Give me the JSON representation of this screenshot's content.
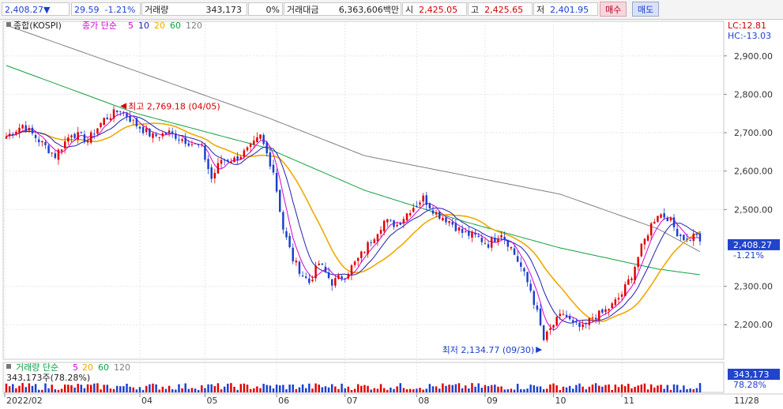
{
  "quote": {
    "price": "2,408.27",
    "change": "29.59",
    "change_pct": "-1.21%",
    "volume_label": "거래량",
    "volume": "343,173",
    "volume_ratio": "0%",
    "amount_label": "거래대금",
    "amount": "6,363,606백만",
    "open_label": "시",
    "open": "2,425.05",
    "high_label": "고",
    "high": "2,425.65",
    "low_label": "저",
    "low": "2,401.95",
    "buy_label": "매수",
    "sell_label": "매도"
  },
  "legend": {
    "symbol": "종합(KOSPI)",
    "price_label": "종가 단순",
    "ma": [
      "5",
      "10",
      "20",
      "60",
      "120"
    ],
    "vol_label": "거래량 단순",
    "vol_ma": [
      "5",
      "20",
      "60",
      "120"
    ],
    "vol_value": "343,173주(78.28%)"
  },
  "colors": {
    "up": "#e00000",
    "down": "#1a3fcf",
    "ma5": "#d400d4",
    "ma10": "#2020b0",
    "ma20": "#f0a800",
    "ma60": "#10a040",
    "ma120": "#808080",
    "price_box": "#2244cc"
  },
  "lc_hc": {
    "lc": "LC:12.81",
    "hc": "HC:-13.03"
  },
  "current_box": {
    "price": "2,408.27",
    "pct": "-1.21%"
  },
  "volume_box": {
    "value": "343,173",
    "pct": "78.28%"
  },
  "chart_data": {
    "type": "candlestick",
    "y_axis_ticks": [
      "2,900.00",
      "2,800.00",
      "2,700.00",
      "2,600.00",
      "2,500.00",
      "2,300.00",
      "2,200.00"
    ],
    "ylim": [
      2110,
      2990
    ],
    "x_axis_ticks": [
      "2022/02",
      "04",
      "05",
      "06",
      "07",
      "08",
      "09",
      "10",
      "11",
      "11/28"
    ],
    "annotations": {
      "high": {
        "text": "최고 2,769.18 (04/05)",
        "value": 2769.18
      },
      "low": {
        "text": "최저 2,134.77 (09/30)",
        "value": 2134.77
      }
    },
    "close_anchors": [
      [
        0,
        2690
      ],
      [
        5,
        2720
      ],
      [
        10,
        2680
      ],
      [
        15,
        2640
      ],
      [
        20,
        2700
      ],
      [
        25,
        2680
      ],
      [
        30,
        2735
      ],
      [
        35,
        2760
      ],
      [
        40,
        2720
      ],
      [
        45,
        2690
      ],
      [
        50,
        2700
      ],
      [
        55,
        2680
      ],
      [
        60,
        2660
      ],
      [
        63,
        2580
      ],
      [
        66,
        2630
      ],
      [
        70,
        2630
      ],
      [
        75,
        2660
      ],
      [
        78,
        2690
      ],
      [
        82,
        2600
      ],
      [
        85,
        2450
      ],
      [
        88,
        2370
      ],
      [
        91,
        2330
      ],
      [
        93,
        2310
      ],
      [
        96,
        2360
      ],
      [
        100,
        2310
      ],
      [
        104,
        2330
      ],
      [
        108,
        2370
      ],
      [
        112,
        2420
      ],
      [
        116,
        2470
      ],
      [
        120,
        2460
      ],
      [
        124,
        2500
      ],
      [
        128,
        2530
      ],
      [
        132,
        2490
      ],
      [
        136,
        2470
      ],
      [
        140,
        2440
      ],
      [
        144,
        2430
      ],
      [
        148,
        2410
      ],
      [
        152,
        2440
      ],
      [
        155,
        2400
      ],
      [
        158,
        2350
      ],
      [
        161,
        2290
      ],
      [
        163,
        2230
      ],
      [
        165,
        2160
      ],
      [
        168,
        2200
      ],
      [
        171,
        2230
      ],
      [
        174,
        2200
      ],
      [
        177,
        2190
      ],
      [
        180,
        2220
      ],
      [
        183,
        2230
      ],
      [
        186,
        2250
      ],
      [
        189,
        2280
      ],
      [
        192,
        2330
      ],
      [
        195,
        2400
      ],
      [
        198,
        2460
      ],
      [
        200,
        2490
      ],
      [
        203,
        2480
      ],
      [
        206,
        2440
      ],
      [
        209,
        2420
      ],
      [
        212,
        2438
      ],
      [
        213,
        2408
      ]
    ],
    "ma60_anchors": [
      [
        0,
        2875
      ],
      [
        40,
        2750
      ],
      [
        80,
        2660
      ],
      [
        110,
        2550
      ],
      [
        140,
        2470
      ],
      [
        170,
        2400
      ],
      [
        200,
        2345
      ],
      [
        213,
        2330
      ]
    ],
    "ma120_anchors": [
      [
        0,
        2980
      ],
      [
        40,
        2860
      ],
      [
        80,
        2740
      ],
      [
        110,
        2640
      ],
      [
        140,
        2590
      ],
      [
        170,
        2540
      ],
      [
        200,
        2450
      ],
      [
        213,
        2390
      ]
    ]
  }
}
